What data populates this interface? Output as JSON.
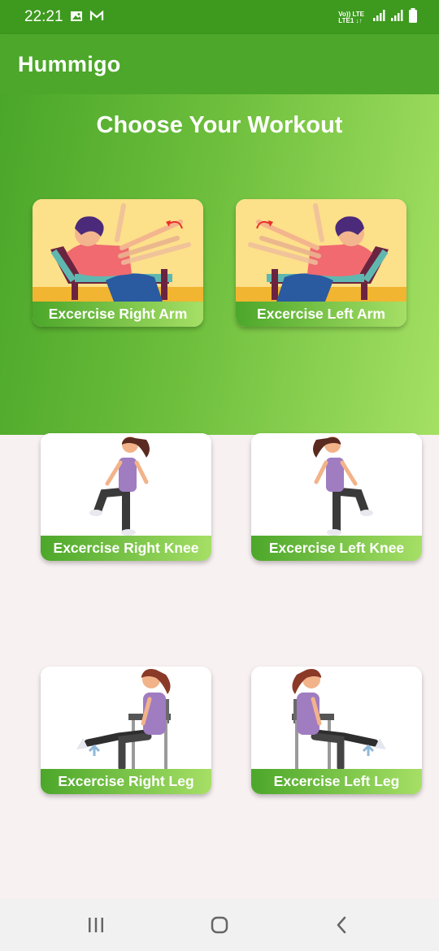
{
  "status_bar": {
    "time": "22:21",
    "network_line1": "Vo)) LTE",
    "network_line2": "LTE1 ↓↑",
    "icons": [
      "gallery-icon",
      "gmail-icon",
      "signal-icon",
      "signal-icon",
      "battery-icon"
    ]
  },
  "app_bar": {
    "title": "Hummigo"
  },
  "hero": {
    "title": "Choose Your Workout"
  },
  "cards": [
    {
      "label": "Excercise Right Arm"
    },
    {
      "label": "Excercise Left Arm"
    },
    {
      "label": "Excercise Right Knee"
    },
    {
      "label": "Excercise Left Knee"
    },
    {
      "label": "Excercise Right Leg"
    },
    {
      "label": "Excercise Left Leg"
    }
  ],
  "nav_bar": {
    "icons": [
      "recent-apps-icon",
      "home-icon",
      "back-icon"
    ]
  },
  "colors": {
    "status_bar": "#3d9a1e",
    "app_bar": "#4ca72a",
    "hero_gradient_start": "#4aa629",
    "hero_gradient_end": "#a4e064",
    "background": "#f8f1f2"
  }
}
